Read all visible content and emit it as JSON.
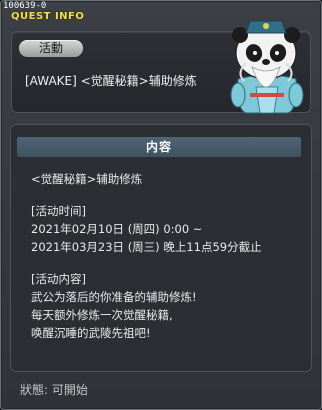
{
  "window": {
    "id_label": "100639-0",
    "title": "QUEST INFO"
  },
  "header": {
    "badge": "活動",
    "quest_title": "[AWAKE] <觉醒秘籍>辅助修炼"
  },
  "content": {
    "header": "内容",
    "lines": [
      "<觉醒秘籍>辅助修炼",
      "",
      "[活动时间]",
      "2021年02月10日 (周四) 0:00 ~",
      "2021年03月23日 (周三) 晚上11点59分截止",
      "",
      "[活动内容]",
      "武公为落后的你准备的辅助修炼!",
      "每天额外修炼一次觉醒秘籍,",
      "唤醒沉睡的武陵先祖吧!"
    ]
  },
  "status": "狀態: 可開始",
  "npc": {
    "icon": "panda-sage-npc-icon"
  }
}
